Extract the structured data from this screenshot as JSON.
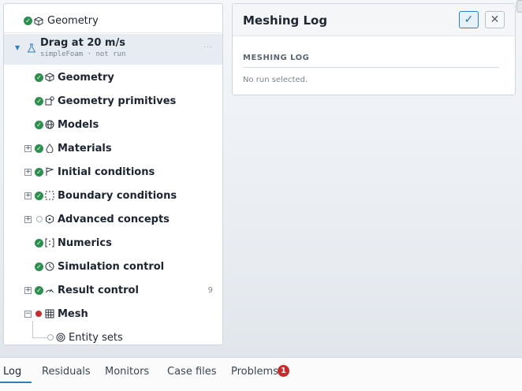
{
  "tree": {
    "top_item": "Geometry",
    "study": {
      "title": "Drag at 20 m/s",
      "subtitle": "simpleFoam · not run",
      "more": "..."
    },
    "items": [
      {
        "label": "Geometry",
        "icon": "cube-icon",
        "status": "done",
        "expandable": false
      },
      {
        "label": "Geometry primitives",
        "icon": "shapes-icon",
        "status": "done",
        "expandable": false
      },
      {
        "label": "Models",
        "icon": "globe-icon",
        "status": "done",
        "expandable": false
      },
      {
        "label": "Materials",
        "icon": "droplet-icon",
        "status": "done",
        "expandable": true
      },
      {
        "label": "Initial conditions",
        "icon": "flag-icon",
        "status": "done",
        "expandable": true
      },
      {
        "label": "Boundary conditions",
        "icon": "boundary-icon",
        "status": "done",
        "expandable": true
      },
      {
        "label": "Advanced concepts",
        "icon": "hexagon-icon",
        "status": "empty",
        "expandable": true
      },
      {
        "label": "Numerics",
        "icon": "numerics-icon",
        "status": "done",
        "expandable": false
      },
      {
        "label": "Simulation control",
        "icon": "clock-icon",
        "status": "done",
        "expandable": false
      },
      {
        "label": "Result control",
        "icon": "gauge-icon",
        "status": "done",
        "expandable": true,
        "count": "9"
      },
      {
        "label": "Mesh",
        "icon": "grid-icon",
        "status": "error",
        "expandable": true,
        "expanded": true
      }
    ],
    "child_item": "Entity sets"
  },
  "log": {
    "title": "Meshing Log",
    "section_title": "MESHING LOG",
    "empty_text": "No run selected.",
    "ok_icon": "✓",
    "close_icon": "✕"
  },
  "bottom_tabs": {
    "tabs": [
      "Log",
      "Residuals",
      "Monitors",
      "Case files",
      "Problems"
    ],
    "active": "Log",
    "problems_count": "1"
  },
  "colors": {
    "accent": "#2c7fb8",
    "success": "#2d8f4e",
    "error": "#c72c2c"
  }
}
